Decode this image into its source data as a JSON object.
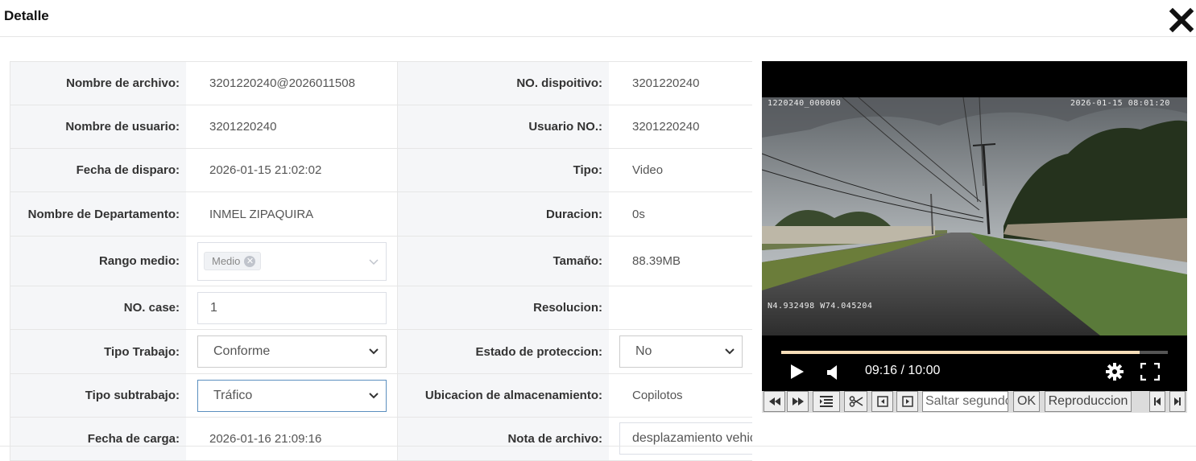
{
  "dialog": {
    "title": "Detalle"
  },
  "fields": {
    "nombre_archivo": {
      "label": "Nombre de archivo:",
      "value": "3201220240@2026011508"
    },
    "no_dispositivo": {
      "label": "NO. dispoitivo:",
      "value": "3201220240"
    },
    "nombre_usuario": {
      "label": "Nombre de usuario:",
      "value": "3201220240"
    },
    "usuario_no": {
      "label": "Usuario NO.:",
      "value": "3201220240"
    },
    "fecha_disparo": {
      "label": "Fecha de disparo:",
      "value": "2026-01-15 21:02:02"
    },
    "tipo": {
      "label": "Tipo:",
      "value": "Video"
    },
    "departamento": {
      "label": "Nombre de Departamento:",
      "value": "INMEL ZIPAQUIRA"
    },
    "duracion": {
      "label": "Duracion:",
      "value": "0s"
    },
    "rango_medio": {
      "label": "Rango medio:",
      "tag": "Medio"
    },
    "tamano": {
      "label": "Tamaño:",
      "value": "88.39MB"
    },
    "no_case": {
      "label": "NO. case:",
      "value": "1"
    },
    "resolucion": {
      "label": "Resolucion:",
      "value": ""
    },
    "tipo_trabajo": {
      "label": "Tipo Trabajo:",
      "value": "Conforme"
    },
    "estado_proteccion": {
      "label": "Estado de proteccion:",
      "value": "No"
    },
    "tipo_subtrabajo": {
      "label": "Tipo subtrabajo:",
      "value": "Tráfico"
    },
    "ubicacion": {
      "label": "Ubicacion de almacenamiento:",
      "value": "Copilotos"
    },
    "fecha_carga": {
      "label": "Fecha de carga:",
      "value": "2026-01-16 21:09:16"
    },
    "nota_archivo": {
      "label": "Nota de archivo:",
      "value": "desplazamiento vehicular .Jhon saavedra"
    }
  },
  "video": {
    "osd_left": "1220240_000000",
    "osd_datetime": "2026-01-15 08:01:20",
    "osd_gps": "N4.932498 W74.045204",
    "timecode": "09:16 / 10:00",
    "progress": 0.927
  },
  "toolbar": {
    "seek_placeholder": "Saltar segundos",
    "ok_label": "OK",
    "playback_label": "Reproduccion"
  }
}
